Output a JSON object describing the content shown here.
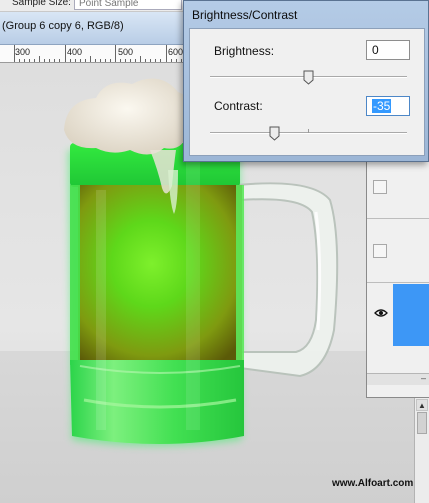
{
  "options_bar": {
    "sample_size_label": "Sample Size:",
    "sample_size_value": "Point Sample"
  },
  "document": {
    "title": "(Group 6 copy 6, RGB/8)"
  },
  "ruler": {
    "labels": [
      "300",
      "400",
      "500",
      "600"
    ]
  },
  "dialog": {
    "title": "Brightness/Contrast",
    "brightness_label": "Brightness:",
    "brightness_value": "0",
    "brightness_level": 0,
    "contrast_label": "Contrast:",
    "contrast_value": "-35",
    "contrast_level": -35
  },
  "layers_panel": {
    "eye_icon": "eye-icon",
    "selected_color": "#3d97f6"
  },
  "watermark": {
    "text": "www.Alfoart.com"
  },
  "colors": {
    "beer_green": "#4fe61e",
    "beer_amber": "#8a9e10",
    "foam": "#efe9dc",
    "glow": "#3df06a"
  }
}
